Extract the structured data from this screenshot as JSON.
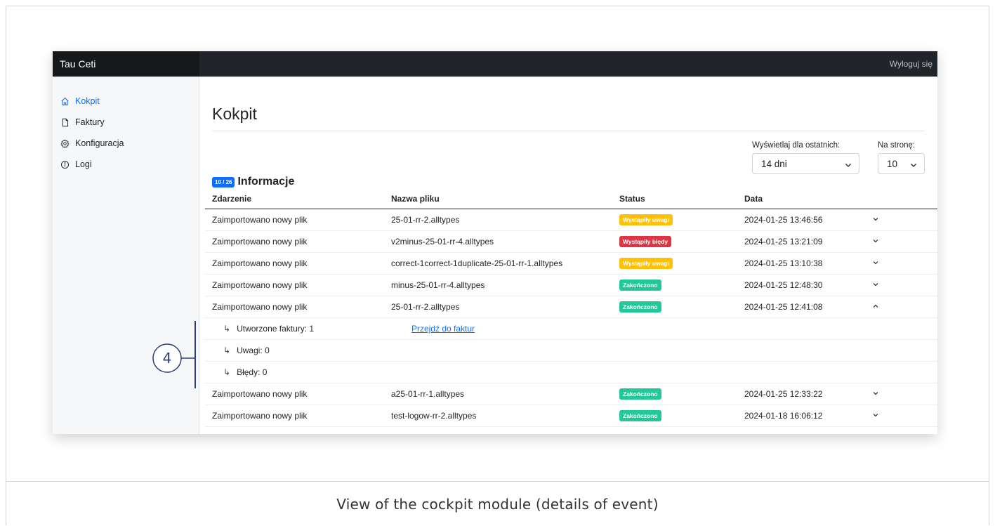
{
  "app": {
    "brand": "Tau Ceti",
    "logout_label": "Wyloguj się"
  },
  "sidebar": {
    "items": [
      {
        "label": "Kokpit",
        "icon": "home-icon",
        "active": true
      },
      {
        "label": "Faktury",
        "icon": "file-icon",
        "active": false
      },
      {
        "label": "Konfiguracja",
        "icon": "gear-icon",
        "active": false
      },
      {
        "label": "Logi",
        "icon": "info-icon",
        "active": false
      }
    ]
  },
  "main": {
    "title": "Kokpit",
    "filters": {
      "period_label": "Wyświetlaj dla ostatnich:",
      "period_value": "14 dni",
      "per_page_label": "Na stronę:",
      "per_page_value": "10"
    },
    "section": {
      "count_badge": "10 / 26",
      "title": "Informacje"
    },
    "table": {
      "headers": [
        "Zdarzenie",
        "Nazwa pliku",
        "Status",
        "Data"
      ],
      "rows": [
        {
          "event": "Zaimportowano nowy plik",
          "file": "25-01-rr-2.alltypes",
          "status": "Wystąpiły uwagi",
          "status_color": "#ffc107",
          "date": "2024-01-25 13:46:56",
          "expanded": false
        },
        {
          "event": "Zaimportowano nowy plik",
          "file": "v2minus-25-01-rr-4.alltypes",
          "status": "Wystąpiły błędy",
          "status_color": "#dc3545",
          "date": "2024-01-25 13:21:09",
          "expanded": false
        },
        {
          "event": "Zaimportowano nowy plik",
          "file": "correct-1correct-1duplicate-25-01-rr-1.alltypes",
          "status": "Wystąpiły uwagi",
          "status_color": "#ffc107",
          "date": "2024-01-25 13:10:38",
          "expanded": false
        },
        {
          "event": "Zaimportowano nowy plik",
          "file": "minus-25-01-rr-4.alltypes",
          "status": "Zakończono",
          "status_color": "#20c997",
          "date": "2024-01-25 12:48:30",
          "expanded": false
        },
        {
          "event": "Zaimportowano nowy plik",
          "file": "25-01-rr-2.alltypes",
          "status": "Zakończono",
          "status_color": "#20c997",
          "date": "2024-01-25 12:41:08",
          "expanded": true
        },
        {
          "event": "Zaimportowano nowy plik",
          "file": "a25-01-rr-1.alltypes",
          "status": "Zakończono",
          "status_color": "#20c997",
          "date": "2024-01-25 12:33:22",
          "expanded": false
        },
        {
          "event": "Zaimportowano nowy plik",
          "file": "test-logow-rr-2.alltypes",
          "status": "Zakończono",
          "status_color": "#20c997",
          "date": "2024-01-18 16:06:12",
          "expanded": false
        }
      ],
      "details": [
        {
          "label": "Utworzone faktury: 1",
          "link": "Przejdź do faktur"
        },
        {
          "label": "Uwagi: 0",
          "link": ""
        },
        {
          "label": "Błędy: 0",
          "link": ""
        }
      ]
    }
  },
  "callout": {
    "number": "4",
    "color": "#2c3e75"
  },
  "caption": "View of the cockpit module (details of event)",
  "colors": {
    "accent": "#0d6efd",
    "topbar": "#212529"
  }
}
